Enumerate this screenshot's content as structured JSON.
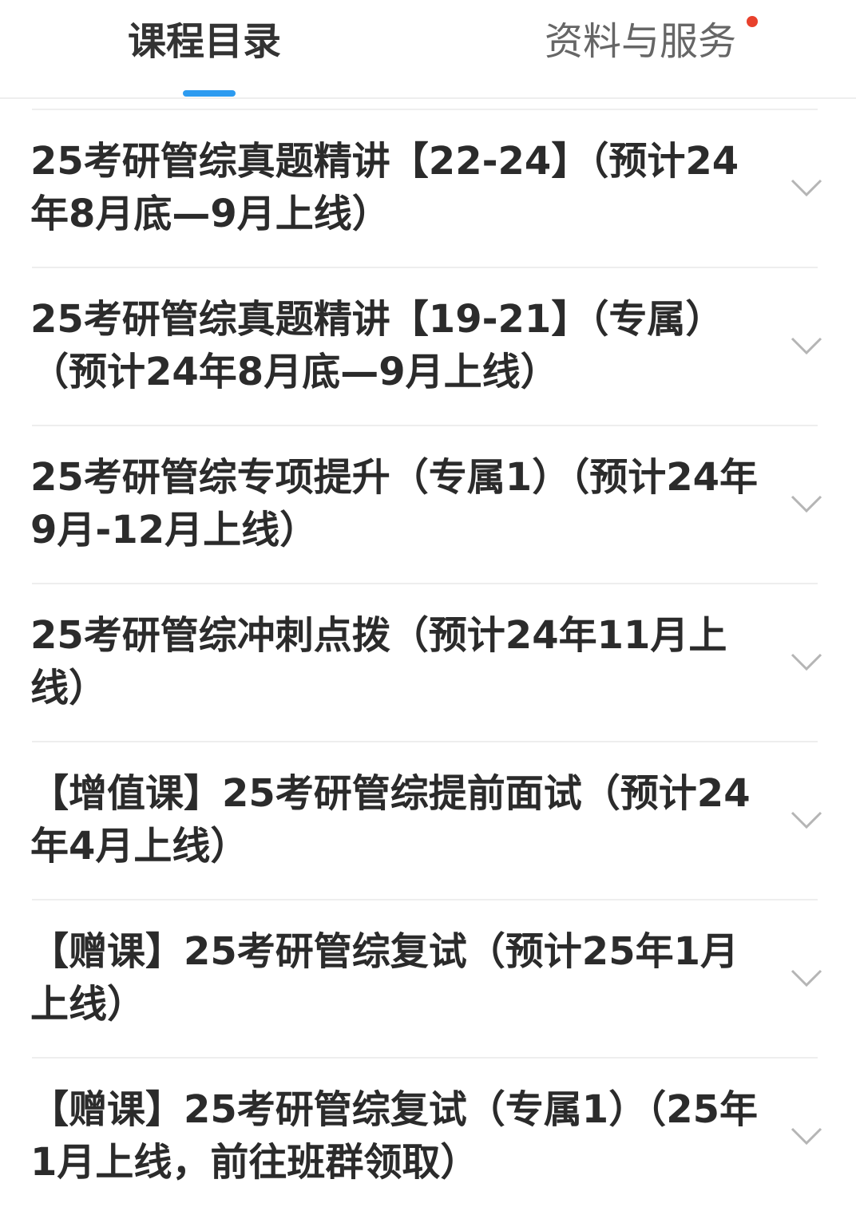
{
  "tabs": {
    "courses_label": "课程目录",
    "materials_label": "资料与服务",
    "active": "courses",
    "indicator_color": "#2d9bf0",
    "notification_dot_color": "#e8412c"
  },
  "courses": [
    {
      "title": "25考研管综真题精讲【22-24】（预计24年8月底—9月上线）",
      "icon": "chevron-down-icon"
    },
    {
      "title": "25考研管综真题精讲【19-21】（专属）（预计24年8月底—9月上线）",
      "icon": "chevron-down-icon"
    },
    {
      "title": "25考研管综专项提升（专属1）（预计24年9月-12月上线）",
      "icon": "chevron-down-icon"
    },
    {
      "title": "25考研管综冲刺点拨（预计24年11月上线）",
      "icon": "chevron-down-icon"
    },
    {
      "title": "【增值课】25考研管综提前面试（预计24年4月上线）",
      "icon": "chevron-down-icon"
    },
    {
      "title": "【赠课】25考研管综复试（预计25年1月上线）",
      "icon": "chevron-down-icon"
    },
    {
      "title": "【赠课】25考研管综复试（专属1）（25年1月上线，前往班群领取）",
      "icon": "chevron-down-icon"
    }
  ]
}
